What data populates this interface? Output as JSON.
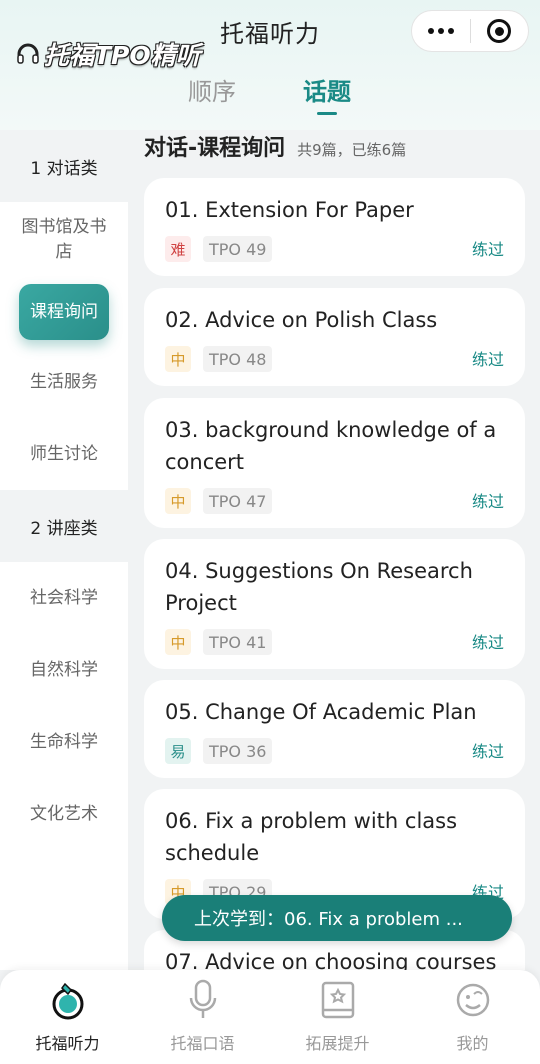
{
  "header": {
    "app_title": "托福听力",
    "watermark": "托福TPO精听",
    "mode_tabs": [
      {
        "label": "顺序",
        "active": false
      },
      {
        "label": "话题",
        "active": true
      }
    ]
  },
  "sidebar": {
    "groups": [
      {
        "label": "1 对话类",
        "items": [
          "图书馆及书店",
          "课程询问",
          "生活服务",
          "师生讨论"
        ]
      },
      {
        "label": "2 讲座类",
        "items": [
          "社会科学",
          "自然科学",
          "生命科学",
          "文化艺术"
        ]
      }
    ],
    "active_item": "课程询问"
  },
  "section": {
    "title": "对话-课程询问",
    "subtitle": "共9篇，已练6篇"
  },
  "cards": [
    {
      "title": "01. Extension For Paper",
      "difficulty": "难",
      "level": "hard",
      "tpo": "TPO 49",
      "status": "练过"
    },
    {
      "title": "02. Advice on Polish Class",
      "difficulty": "中",
      "level": "mid",
      "tpo": "TPO 48",
      "status": "练过"
    },
    {
      "title": "03. background knowledge of a concert",
      "difficulty": "中",
      "level": "mid",
      "tpo": "TPO 47",
      "status": "练过"
    },
    {
      "title": "04. Suggestions On Research Project",
      "difficulty": "中",
      "level": "mid",
      "tpo": "TPO 41",
      "status": "练过"
    },
    {
      "title": "05. Change Of Academic Plan",
      "difficulty": "易",
      "level": "easy",
      "tpo": "TPO 36",
      "status": "练过"
    },
    {
      "title": "06. Fix a problem with class schedule",
      "difficulty": "中",
      "level": "mid",
      "tpo": "TPO 29",
      "status": "练过"
    },
    {
      "title": "07. Advice on choosing courses",
      "difficulty": "",
      "level": "",
      "tpo": "",
      "status": ""
    }
  ],
  "resume_banner": "上次学到：06. Fix a problem ...",
  "tabbar": [
    {
      "label": "托福听力",
      "icon": "listening-icon",
      "active": true
    },
    {
      "label": "托福口语",
      "icon": "microphone-icon",
      "active": false
    },
    {
      "label": "拓展提升",
      "icon": "book-icon",
      "active": false
    },
    {
      "label": "我的",
      "icon": "profile-icon",
      "active": false
    }
  ],
  "colors": {
    "accent": "#1a8a86",
    "banner": "#1a7f78",
    "hard": "#d04343",
    "mid": "#d69a2a",
    "easy": "#2a8f8a"
  }
}
